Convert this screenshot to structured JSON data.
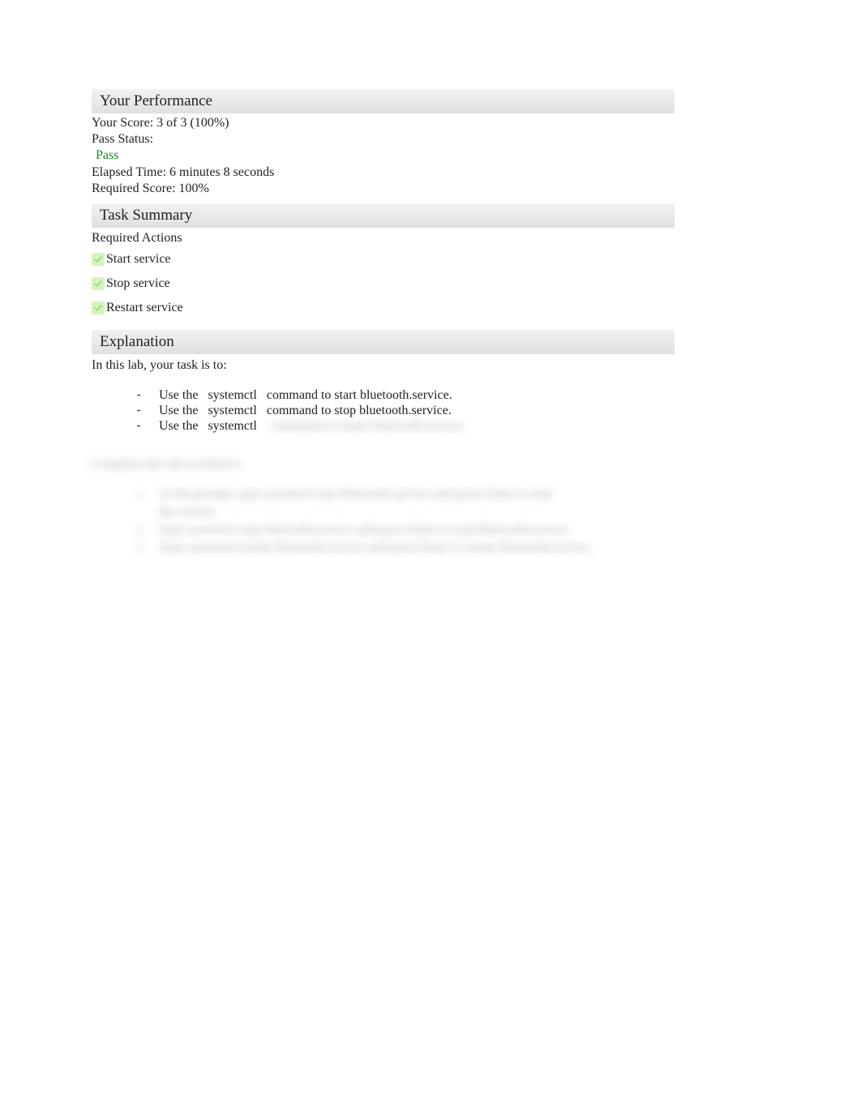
{
  "performance": {
    "header": "Your Performance",
    "score_line": "Your Score: 3 of 3 (100%)",
    "pass_status_label": "Pass Status:",
    "pass_status_value": "Pass",
    "elapsed_time": "Elapsed Time: 6 minutes 8 seconds",
    "required_score": "Required Score: 100%"
  },
  "task_summary": {
    "header": "Task Summary",
    "required_actions_label": "Required Actions",
    "actions": [
      "Start service",
      "Stop service",
      "Restart service"
    ]
  },
  "explanation": {
    "header": "Explanation",
    "intro": "In this lab, your task is to:",
    "bullets": [
      {
        "prefix": "Use the",
        "cmd": "systemctl",
        "suffix": "command to start bluetooth.service."
      },
      {
        "prefix": "Use the",
        "cmd": "systemctl",
        "suffix": "command to stop bluetooth.service."
      },
      {
        "prefix": "Use the",
        "cmd": "systemctl",
        "suffix": "command to restart bluetooth.service."
      }
    ],
    "blurred_intro": "Complete this lab as follows:",
    "blurred_steps": [
      "At the prompt, type   systemctl start bluetooth.service   and press   Enter   to start",
      "the service.",
      "Type   systemctl stop bluetooth.service   and press   Enter   to stop bluetooth.service.",
      "Type   systemctl restart bluetooth.service   and press   Enter   to restart bluetooth.service."
    ]
  }
}
